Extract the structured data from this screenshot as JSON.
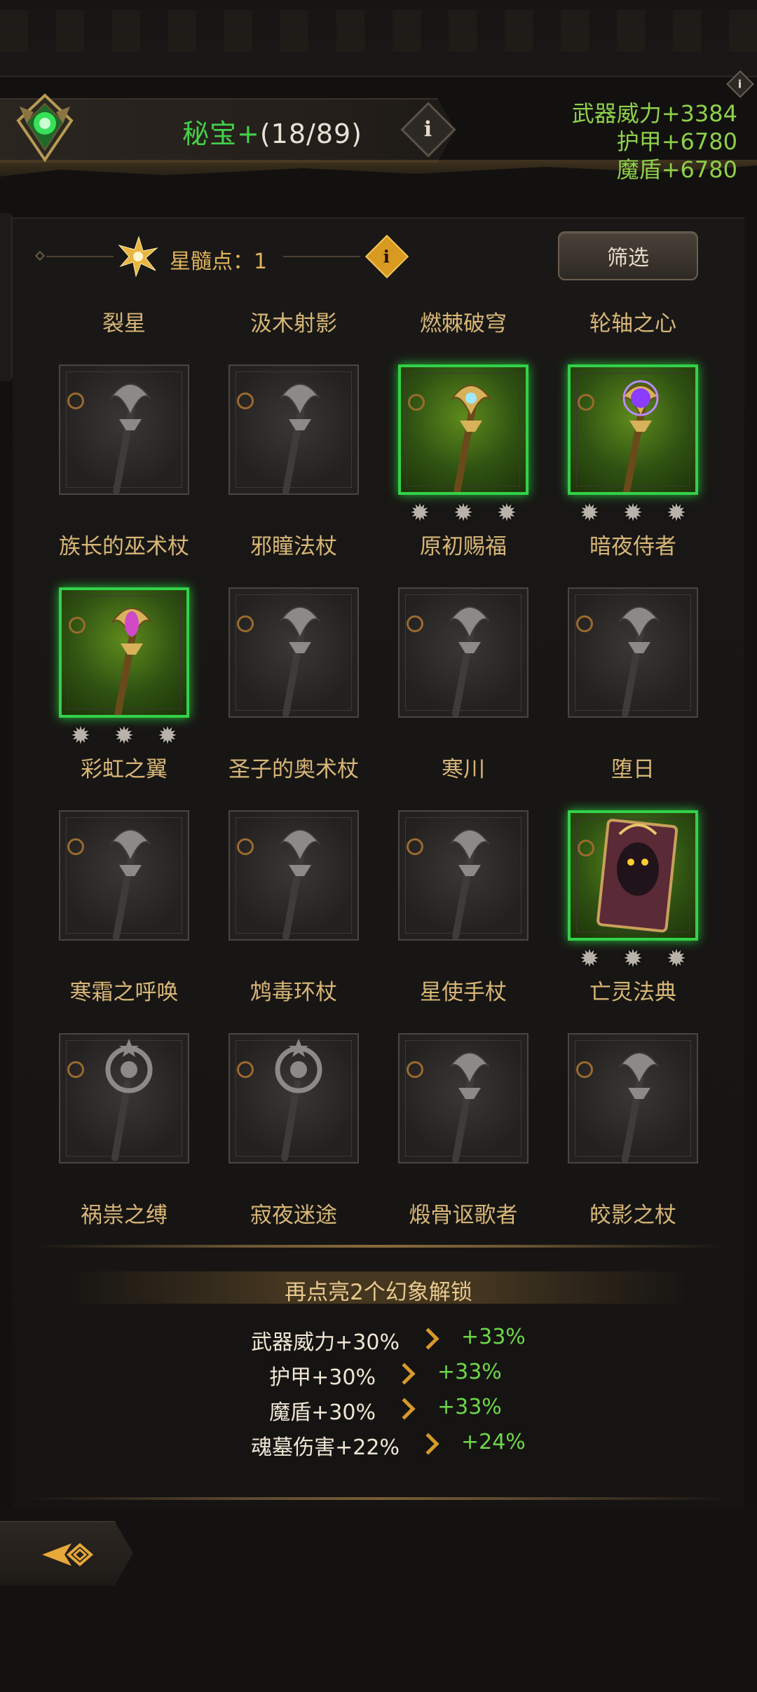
{
  "header": {
    "title_prefix": "秘宝+",
    "title_count": "(18/89)",
    "info_label": "i",
    "stats": [
      "武器威力+3384",
      "护甲+6780",
      "魔盾+6780"
    ]
  },
  "toolbar": {
    "star_points_label": "星髓点：",
    "star_points_value": "1",
    "filter_label": "筛选"
  },
  "icons": {
    "emblem": "green-gem-emblem-icon",
    "star_points": "star-burst-icon",
    "info": "info-icon",
    "slot_ring": "unselected-ring-icon",
    "star_rank": "silver-star-icon",
    "back": "back-arrow-icon"
  },
  "items": [
    {
      "name": "裂星",
      "unlocked": false,
      "stars": 0,
      "art": "staff"
    },
    {
      "name": "汲木射影",
      "unlocked": false,
      "stars": 0,
      "art": "staff"
    },
    {
      "name": "燃棘破穹",
      "unlocked": true,
      "stars": 3,
      "art": "gold-staff"
    },
    {
      "name": "轮轴之心",
      "unlocked": true,
      "stars": 3,
      "art": "purple-staff"
    },
    {
      "name": "族长的巫术杖",
      "unlocked": true,
      "stars": 3,
      "art": "crystal-staff"
    },
    {
      "name": "邪瞳法杖",
      "unlocked": false,
      "stars": 0,
      "art": "staff"
    },
    {
      "name": "原初赐福",
      "unlocked": false,
      "stars": 0,
      "art": "staff"
    },
    {
      "name": "暗夜侍者",
      "unlocked": false,
      "stars": 0,
      "art": "staff"
    },
    {
      "name": "彩虹之翼",
      "unlocked": false,
      "stars": 0,
      "art": "staff"
    },
    {
      "name": "圣子的奥术杖",
      "unlocked": false,
      "stars": 0,
      "art": "staff"
    },
    {
      "name": "寒川",
      "unlocked": false,
      "stars": 0,
      "art": "staff"
    },
    {
      "name": "堕日",
      "unlocked": true,
      "stars": 3,
      "art": "tome"
    },
    {
      "name": "寒霜之呼唤",
      "unlocked": false,
      "stars": 0,
      "art": "orb"
    },
    {
      "name": "鸩毒环杖",
      "unlocked": false,
      "stars": 0,
      "art": "orb"
    },
    {
      "name": "星使手杖",
      "unlocked": false,
      "stars": 0,
      "art": "staff"
    },
    {
      "name": "亡灵法典",
      "unlocked": false,
      "stars": 0,
      "art": "staff"
    },
    {
      "name": "祸祟之缚",
      "unlocked": false,
      "stars": 0,
      "art": "none"
    },
    {
      "name": "寂夜迷途",
      "unlocked": false,
      "stars": 0,
      "art": "none"
    },
    {
      "name": "煅骨讴歌者",
      "unlocked": false,
      "stars": 0,
      "art": "none"
    },
    {
      "name": "皎影之杖",
      "unlocked": false,
      "stars": 0,
      "art": "none"
    }
  ],
  "unlock": {
    "banner": "再点亮2个幻象解锁",
    "rows": [
      {
        "current": "武器威力+30%",
        "next": "+33%"
      },
      {
        "current": "护甲+30%",
        "next": "+33%"
      },
      {
        "current": "魔盾+30%",
        "next": "+33%"
      },
      {
        "current": "魂墓伤害+22%",
        "next": "+24%"
      }
    ]
  },
  "colors": {
    "accent_green": "#45d04a",
    "stat_green": "#8ed04a",
    "gold_text": "#d7b677",
    "unlocked_border": "#33d14a",
    "arrow_gold": "#d79a2a"
  }
}
